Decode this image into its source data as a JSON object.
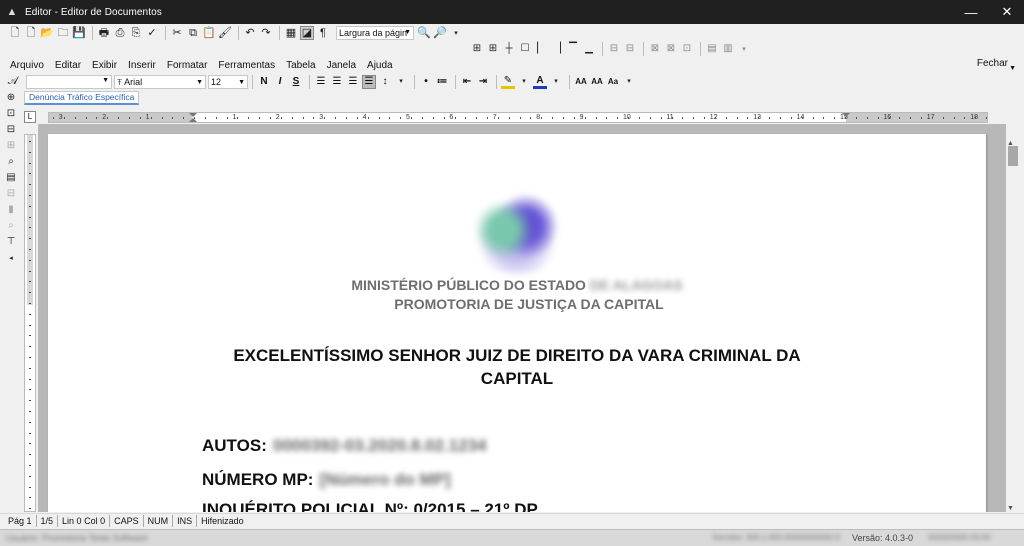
{
  "window": {
    "title": "Editor - Editor de Documentos",
    "app_icon": "app-icon",
    "controls": {
      "minimize": "—",
      "close": "✕"
    }
  },
  "toolbar1": {
    "zoom_value": "Largura da págin"
  },
  "menubar": {
    "items": [
      {
        "label": "Arquivo"
      },
      {
        "label": "Editar"
      },
      {
        "label": "Exibir"
      },
      {
        "label": "Inserir"
      },
      {
        "label": "Formatar"
      },
      {
        "label": "Ferramentas"
      },
      {
        "label": "Tabela"
      },
      {
        "label": "Janela"
      },
      {
        "label": "Ajuda"
      }
    ],
    "close_label": "Fechar"
  },
  "format_bar": {
    "style_value": "",
    "font_value": "Arial",
    "size_value": "12",
    "bold": "N",
    "italic": "I",
    "strike": "S"
  },
  "tabs": [
    {
      "label": "Denúncia Tráfico Específica",
      "active": true
    }
  ],
  "ruler": {
    "numbers": [
      "3",
      "2",
      "1",
      "1",
      "2",
      "3",
      "4",
      "5",
      "6",
      "7",
      "8",
      "9",
      "10",
      "11",
      "12",
      "13",
      "14",
      "15",
      "16",
      "17",
      "18"
    ]
  },
  "document": {
    "org_line1": "MINISTÉRIO PÚBLICO DO ESTADO",
    "org_line1_redacted": "DE ALAGOAS",
    "org_line2": "PROMOTORIA DE JUSTIÇA DA CAPITAL",
    "addressee_line1": "EXCELENTÍSSIMO SENHOR JUIZ DE DIREITO DA  VARA CRIMINAL DA",
    "addressee_line2": "CAPITAL",
    "autos_label": "AUTOS:",
    "autos_value": "0000392-03.2020.8.02.1234",
    "numero_mp_label": "NÚMERO MP:",
    "numero_mp_value": "[Número do MP]",
    "inquerito_label": "INQUÉRITO POLICIAL Nº: 0/2015 – 21º DP"
  },
  "statusbar": {
    "page": "Pág 1",
    "pages": "1/5",
    "position": "Lin 0  Col 0",
    "caps": "CAPS",
    "num": "NUM",
    "ins": "INS",
    "hyphen": "Hifenizado"
  },
  "bottom_bar": {
    "left_info": "Usuário: Promotoria Teste Software",
    "mid_info": "Servidor: 000.1.000.00000000000-0",
    "version": "Versão: 4.0.3-0",
    "right_info": "00/00/0000 00:00"
  }
}
